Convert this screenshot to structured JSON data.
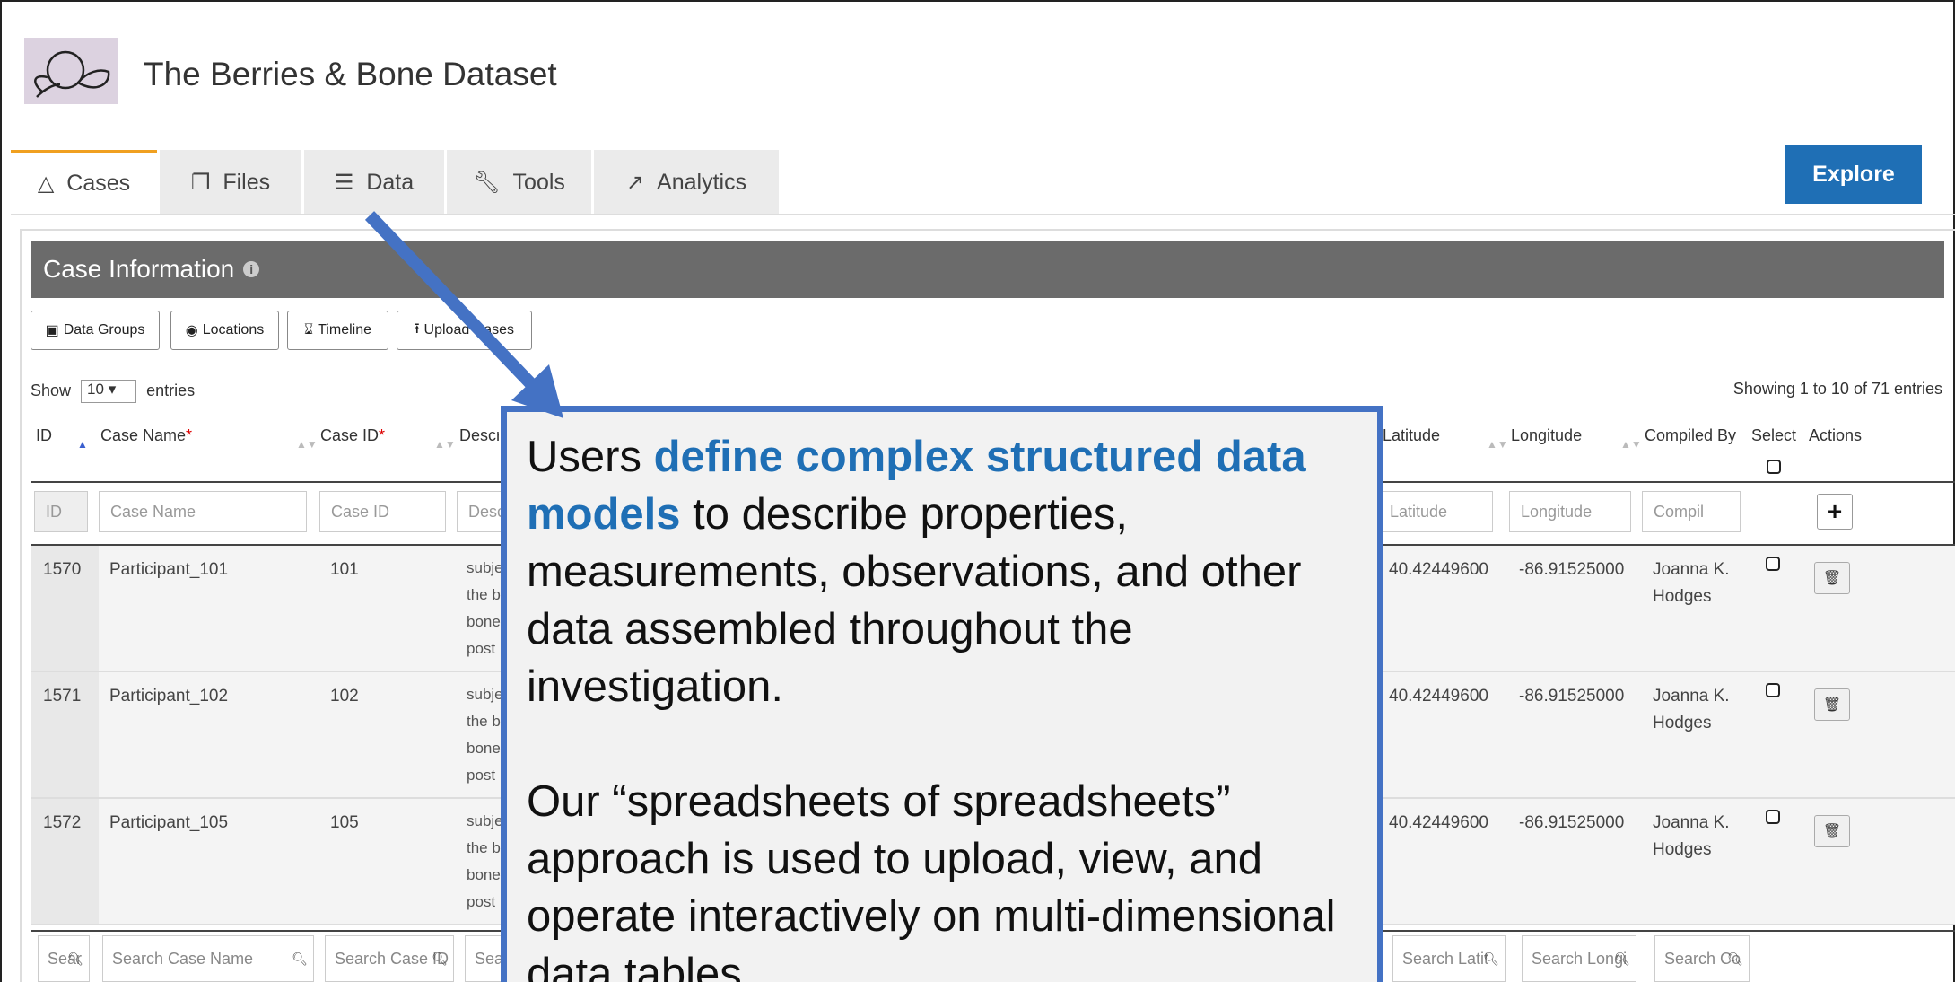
{
  "app": {
    "title": "The Berries & Bone Dataset",
    "logo_icon": "berry-leaf-icon"
  },
  "tabs": [
    {
      "label": "Cases",
      "icon": "flask-icon"
    },
    {
      "label": "Files",
      "icon": "files-icon"
    },
    {
      "label": "Data",
      "icon": "database-icon"
    },
    {
      "label": "Tools",
      "icon": "wrench-icon"
    },
    {
      "label": "Analytics",
      "icon": "line-chart-icon"
    }
  ],
  "explore_label": "Explore",
  "section": {
    "title": "Case Information"
  },
  "toolbar": {
    "data_groups": "Data Groups",
    "locations": "Locations",
    "timeline": "Timeline",
    "upload_cases": "Upload Cases"
  },
  "table": {
    "show_label": "Show",
    "entries_value": "10",
    "entries_label": "entries",
    "info": "Showing 1 to 10 of 71 entries",
    "headers": {
      "id": "ID",
      "case_name": "Case Name",
      "case_id": "Case ID",
      "description": "Description",
      "latitude": "Latitude",
      "longitude": "Longitude",
      "compiled_by": "Compiled By",
      "select": "Select",
      "actions": "Actions"
    },
    "filters": {
      "id": "ID",
      "case_name": "Case Name",
      "case_id": "Case ID",
      "description": "Desc",
      "latitude": "Latitude",
      "longitude": "Longitude",
      "compiled_by": "Compil"
    },
    "rows": [
      {
        "id": "1570",
        "case_name": "Participant_101",
        "case_id": "101",
        "desc1": "subje",
        "desc2": "the b",
        "desc3": "bone",
        "desc4": "post",
        "latitude": "40.42449600",
        "longitude": "-86.91525000",
        "compiled1": "Joanna K.",
        "compiled2": "Hodges"
      },
      {
        "id": "1571",
        "case_name": "Participant_102",
        "case_id": "102",
        "desc1": "subje",
        "desc2": "the b",
        "desc3": "bone",
        "desc4": "post",
        "latitude": "40.42449600",
        "longitude": "-86.91525000",
        "compiled1": "Joanna K.",
        "compiled2": "Hodges"
      },
      {
        "id": "1572",
        "case_name": "Participant_105",
        "case_id": "105",
        "desc1": "subje",
        "desc2": "the b",
        "desc3": "bone",
        "desc4": "post",
        "latitude": "40.42449600",
        "longitude": "-86.91525000",
        "compiled1": "Joanna K.",
        "compiled2": "Hodges"
      }
    ],
    "search": {
      "id": "Sear",
      "case_name": "Search Case Name",
      "case_id": "Search Case ID",
      "description": "Sea",
      "latitude": "Search Latit",
      "longitude": "Search Longi",
      "compiled_by": "Search Co"
    }
  },
  "callout": {
    "p1_pre": "Users ",
    "p1_highlight": "define complex structured data models",
    "p1_post": " to describe properties, measurements, observations, and other data assembled throughout the investigation.",
    "p2": "Our “spreadsheets of spreadsheets” approach is used to upload, view, and operate interactively on multi-dimensional data tables."
  }
}
